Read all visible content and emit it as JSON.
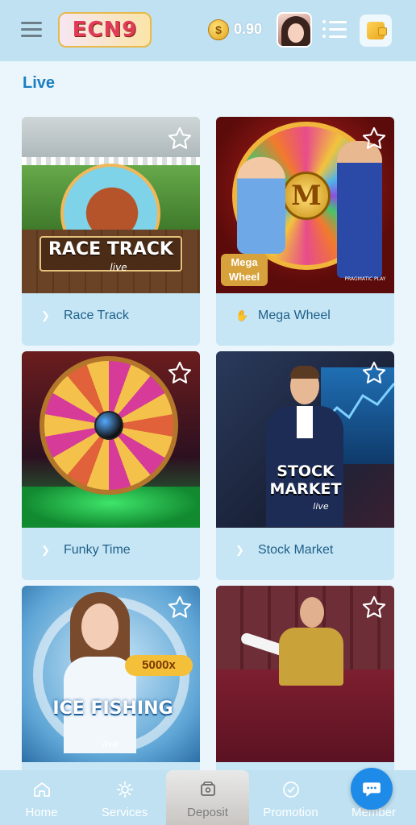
{
  "header": {
    "logo_text": "ECN9",
    "balance": "0.90",
    "coin_symbol": "$"
  },
  "section": {
    "title": "Live"
  },
  "games": [
    {
      "name": "Race Track",
      "art_title": "RACE TRACK",
      "art_sub": "live"
    },
    {
      "name": "Mega Wheel",
      "art_title": "Mega Wheel",
      "art_sub": "PRAGMATIC PLAY"
    },
    {
      "name": "Funky Time",
      "art_title": "",
      "art_sub": ""
    },
    {
      "name": "Stock Market",
      "art_title": "STOCK MARKET",
      "art_sub": "live"
    },
    {
      "name": "",
      "art_title": "ICE FISHING",
      "art_sub": "live",
      "badge": "5000x"
    },
    {
      "name": "",
      "art_title": "",
      "art_sub": ""
    }
  ],
  "bottom_nav": {
    "items": [
      {
        "label": "Home",
        "icon": "home-icon"
      },
      {
        "label": "Services",
        "icon": "services-icon"
      },
      {
        "label": "Deposit",
        "icon": "deposit-icon"
      },
      {
        "label": "Promotion",
        "icon": "promotion-icon"
      },
      {
        "label": "Member",
        "icon": "member-icon"
      }
    ]
  },
  "colors": {
    "header_bg": "#bfe1f2",
    "section_title": "#1a7ec2",
    "label_text": "#20608a",
    "chat_button": "#1f8be8"
  }
}
